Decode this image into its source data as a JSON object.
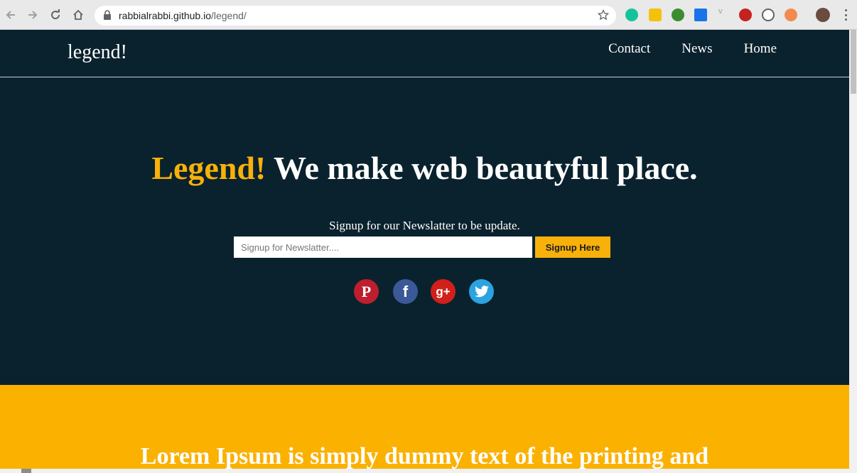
{
  "browser": {
    "url_host": "rabbialrabbi.github.io",
    "url_path": "/legend/",
    "extension_icons": [
      "grammarly-icon",
      "notes-extension-icon",
      "globe-extension-icon",
      "square-extension-icon",
      "v-extension-icon",
      "red-extension-icon",
      "circle-extension-icon",
      "orange-extension-icon"
    ]
  },
  "site": {
    "brand": "legend!",
    "nav": [
      {
        "label": "Contact"
      },
      {
        "label": "News"
      },
      {
        "label": "Home"
      }
    ]
  },
  "hero": {
    "title_accent": "Legend!",
    "title_rest": " We make web beautyful place.",
    "subtitle": "Signup for our Newslatter to be update.",
    "input_placeholder": "Signup for Newslatter....",
    "button_label": "Signup Here"
  },
  "social": [
    {
      "name": "pinterest-icon",
      "glyph": "P",
      "color": "#be1e2d"
    },
    {
      "name": "facebook-icon",
      "glyph": "f",
      "color": "#3b5998"
    },
    {
      "name": "google-plus-icon",
      "glyph": "g+",
      "color": "#d0201a"
    },
    {
      "name": "twitter-icon",
      "glyph": "t",
      "color": "#2aa3e0"
    }
  ],
  "section2": {
    "title": "Lorem Ipsum is simply dummy text of the printing and"
  },
  "colors": {
    "page_bg": "#0a222d",
    "accent": "#f8b10b",
    "yellow_section": "#fbb100"
  }
}
